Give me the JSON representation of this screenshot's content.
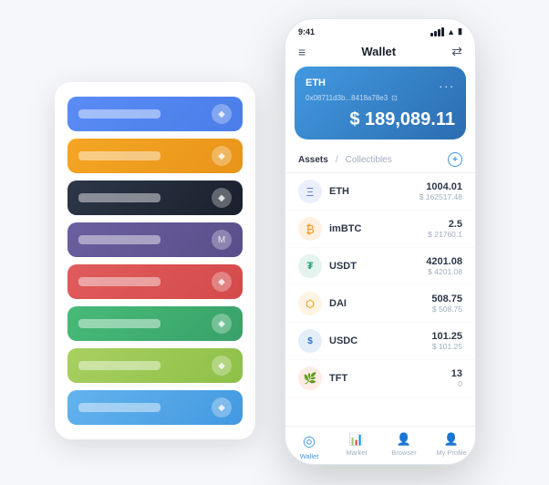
{
  "leftPanel": {
    "cards": [
      {
        "color": "card-blue",
        "icon": "◆"
      },
      {
        "color": "card-orange",
        "icon": "◆"
      },
      {
        "color": "card-dark",
        "icon": "◆"
      },
      {
        "color": "card-purple",
        "icon": "M"
      },
      {
        "color": "card-red",
        "icon": "◆"
      },
      {
        "color": "card-green",
        "icon": "◆"
      },
      {
        "color": "card-lime",
        "icon": "◆"
      },
      {
        "color": "card-sky",
        "icon": "◆"
      }
    ]
  },
  "phone": {
    "statusBar": {
      "time": "9:41"
    },
    "header": {
      "menuIcon": "≡",
      "title": "Wallet",
      "scanIcon": "⇄"
    },
    "ethCard": {
      "name": "ETH",
      "address": "0x08711d3b...8418a78e3",
      "copyIcon": "⊡",
      "moreIcon": "...",
      "currencySymbol": "$",
      "balance": "189,089.11"
    },
    "assets": {
      "activeTab": "Assets",
      "divider": "/",
      "inactiveTab": "Collectibles",
      "addIcon": "+"
    },
    "tokens": [
      {
        "name": "ETH",
        "icon": "Ξ",
        "iconClass": "icon-eth",
        "amount": "1004.01",
        "usd": "$ 162517.48"
      },
      {
        "name": "imBTC",
        "icon": "₿",
        "iconClass": "icon-imbtc",
        "amount": "2.5",
        "usd": "$ 21760.1"
      },
      {
        "name": "USDT",
        "icon": "₮",
        "iconClass": "icon-usdt",
        "amount": "4201.08",
        "usd": "$ 4201.08"
      },
      {
        "name": "DAI",
        "icon": "◈",
        "iconClass": "icon-dai",
        "amount": "508.75",
        "usd": "$ 508.75"
      },
      {
        "name": "USDC",
        "icon": "$",
        "iconClass": "icon-usdc",
        "amount": "101.25",
        "usd": "$ 101.25"
      },
      {
        "name": "TFT",
        "icon": "🌿",
        "iconClass": "icon-tft",
        "amount": "13",
        "usd": "0"
      }
    ],
    "bottomNav": [
      {
        "label": "Wallet",
        "icon": "◎",
        "active": true
      },
      {
        "label": "Market",
        "icon": "📈",
        "active": false
      },
      {
        "label": "Browser",
        "icon": "🌐",
        "active": false
      },
      {
        "label": "My Profile",
        "icon": "👤",
        "active": false
      }
    ]
  }
}
